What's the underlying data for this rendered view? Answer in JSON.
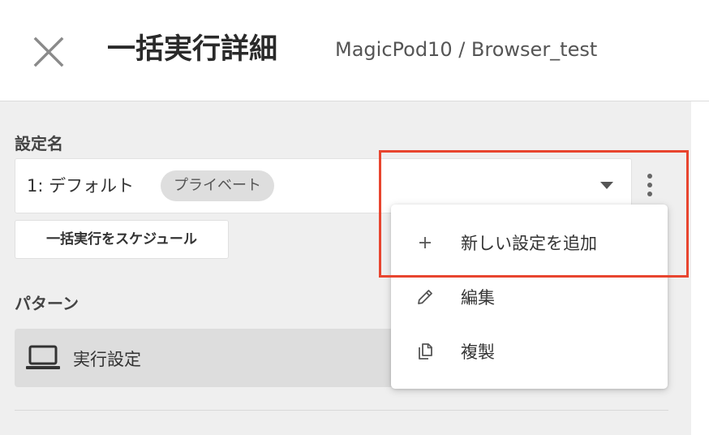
{
  "header": {
    "title": "一括実行詳細",
    "project_path": "MagicPod10 / Browser_test",
    "close_icon": "close-icon"
  },
  "settings": {
    "label": "設定名",
    "selected_value": "1: デフォルト",
    "badge": "プライベート"
  },
  "schedule_button": {
    "label": "一括実行をスケジュール"
  },
  "pattern": {
    "label": "パターン",
    "item_label": "実行設定",
    "item_icon": "laptop-icon"
  },
  "menu": {
    "items": [
      {
        "icon": "plus-icon",
        "label": "新しい設定を追加"
      },
      {
        "icon": "pencil-icon",
        "label": "編集"
      },
      {
        "icon": "copy-icon",
        "label": "複製"
      }
    ]
  },
  "colors": {
    "highlight": "#e8452f",
    "content_background": "#efefef",
    "pattern_background": "#dddddd",
    "badge_background": "#dedede"
  }
}
